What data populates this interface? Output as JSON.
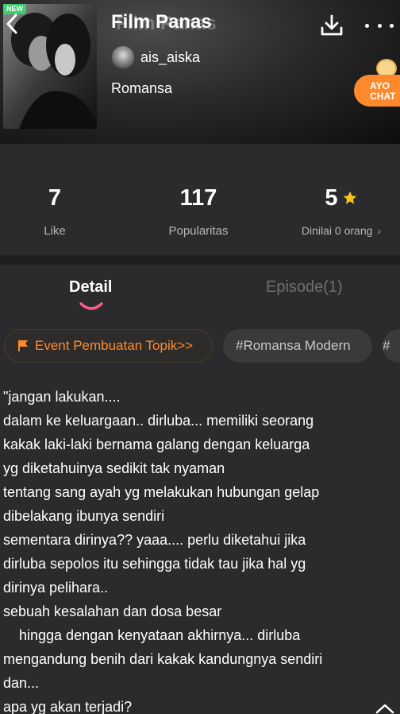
{
  "header": {
    "badge": "NEW",
    "title": "Film Panas",
    "title_ghost": "Film Panas",
    "author": "ais_aiska",
    "genre": "Romansa",
    "chat_promo": {
      "line1": "AYO",
      "line2": "CHAT"
    }
  },
  "icons": {
    "back": "chevron-left-icon",
    "download": "download-icon",
    "more": "more-dots-icon",
    "star": "star-icon",
    "flag": "flag-icon",
    "collapse": "chevron-up-icon"
  },
  "stats": {
    "like": {
      "value": "7",
      "label": "Like"
    },
    "popularity": {
      "value": "117",
      "label": "Popularitas"
    },
    "rating": {
      "value": "5",
      "label": "Dinilai 0 orang",
      "chevron": "›"
    }
  },
  "tabs": {
    "detail": "Detail",
    "episode": "Episode(1)"
  },
  "tags": [
    {
      "label": "Event Pembuatan Topik>>"
    },
    {
      "label": "#Romansa Modern"
    },
    {
      "label": "#"
    }
  ],
  "description": [
    "\"jangan lakukan....",
    "dalam ke keluargaan.. dirluba... memiliki seorang",
    "kakak laki-laki bernama galang dengan keluarga",
    "yg diketahuinya sedikit tak nyaman",
    "tentang sang ayah yg melakukan hubungan gelap",
    "dibelakang ibunya sendiri",
    "sementara dirinya?? yaaa.... perlu diketahui jika",
    "dirluba sepolos itu sehingga tidak tau jika hal yg",
    "dirinya pelihara..",
    "sebuah kesalahan dan dosa besar",
    "    hingga dengan kenyataan akhirnya... dirluba",
    "mengandung benih dari kakak kandungnya sendiri",
    "dan...",
    "apa yg akan terjadi?"
  ],
  "colors": {
    "accent_orange": "#ff8a2d",
    "star_yellow": "#ffc21a",
    "tab_indicator": "#ff5a8a",
    "background": "#2b2b2d"
  }
}
